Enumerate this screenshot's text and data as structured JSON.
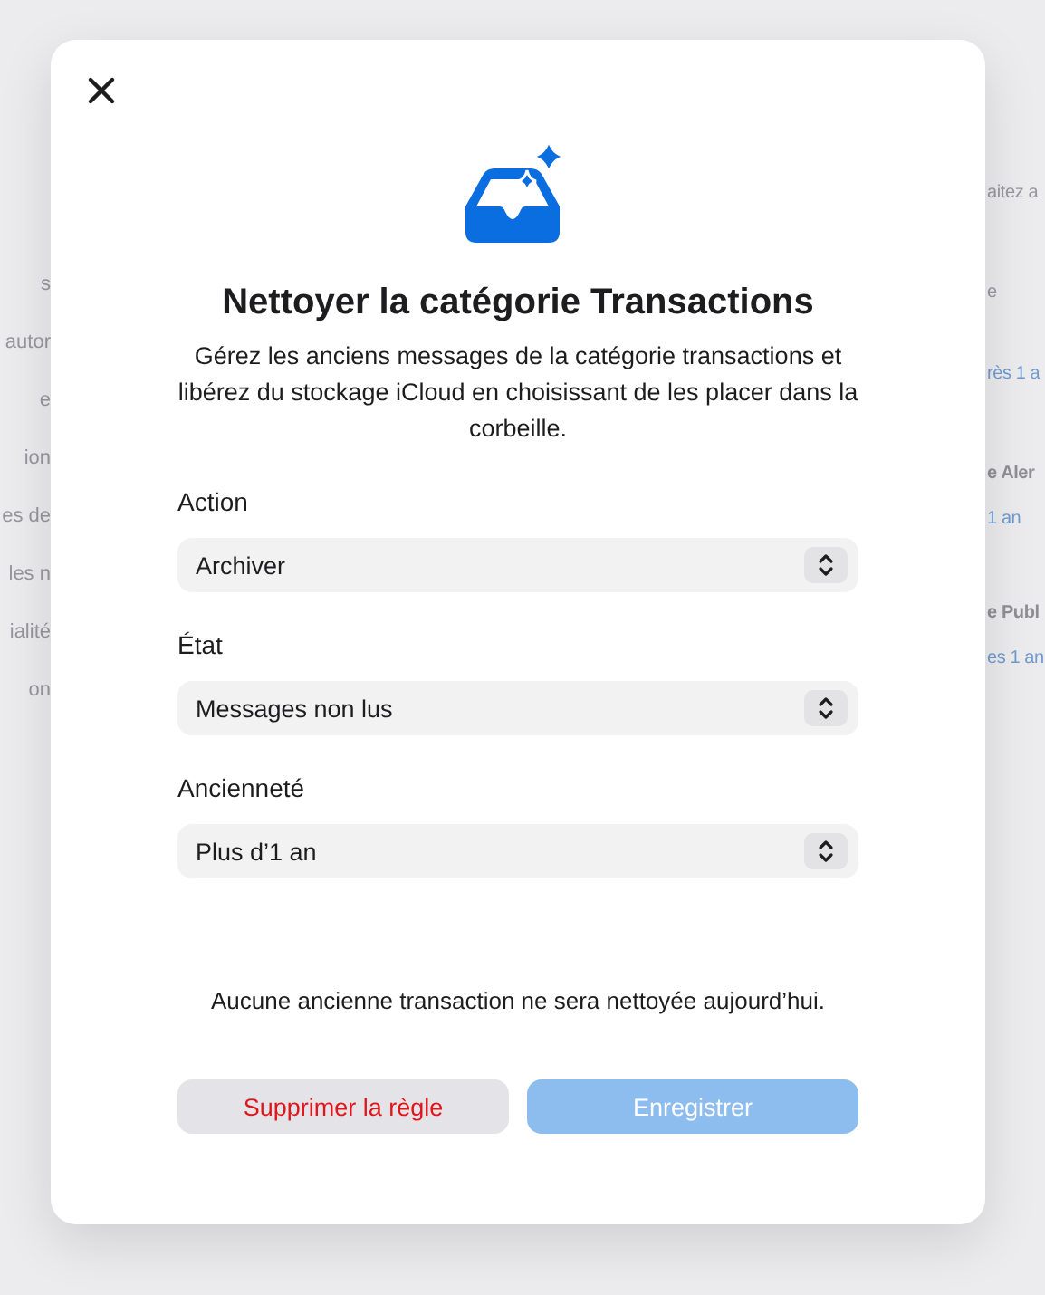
{
  "background": {
    "left_fragments": [
      {
        "text": "s"
      },
      {
        "text": "autor"
      },
      {
        "text": "e"
      },
      {
        "text": "ion"
      },
      {
        "text": "es de"
      },
      {
        "text": "les n"
      },
      {
        "text": "ialité"
      },
      {
        "text": "on"
      }
    ],
    "right_fragments": [
      {
        "text": "aitez a",
        "kind": "text"
      },
      {
        "text": "e",
        "kind": "text"
      },
      {
        "text": "rès 1 a",
        "kind": "link"
      },
      {
        "text": "e Aler",
        "kind": "title"
      },
      {
        "text": "1 an",
        "kind": "link"
      },
      {
        "text": "e Publ",
        "kind": "title"
      },
      {
        "text": "es 1 an",
        "kind": "link"
      }
    ]
  },
  "dialog": {
    "title": "Nettoyer la catégorie Transactions",
    "description": "Gérez les anciens messages de la catégorie transactions et libérez du stockage iCloud en choisissant de les placer dans la corbeille.",
    "fields": [
      {
        "label": "Action",
        "value": "Archiver"
      },
      {
        "label": "État",
        "value": "Messages non lus"
      },
      {
        "label": "Ancienneté",
        "value": "Plus d’1 an"
      }
    ],
    "note": "Aucune ancienne transaction ne sera nettoyée aujourd’hui.",
    "buttons": [
      {
        "label": "Supprimer la règle",
        "kind": "destructive",
        "disabled": false
      },
      {
        "label": "Enregistrer",
        "kind": "primary",
        "disabled": true
      }
    ]
  }
}
